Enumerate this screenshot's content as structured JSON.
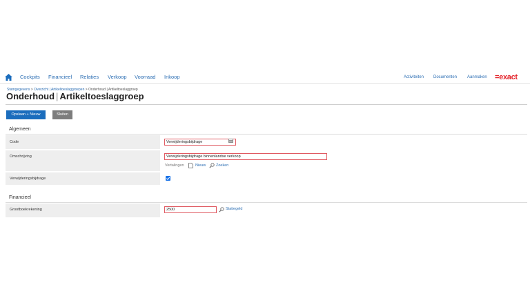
{
  "nav": {
    "items": [
      "Cockpits",
      "Financieel",
      "Relaties",
      "Verkoop",
      "Voorraad",
      "Inkoop"
    ],
    "right": [
      "Activiteiten",
      "Documenten",
      "Aanmaken"
    ],
    "logo": "=exact"
  },
  "breadcrumb": {
    "stamgegevens": "Stamgegevens",
    "sep1": " > ",
    "overzicht": "Overzicht | Artikeltoeslaggroepen",
    "sep2": " > ",
    "current": "Onderhoud | Artikeltoeslaggroep"
  },
  "title": {
    "part1": "Onderhoud",
    "sep": "|",
    "part2": "Artikeltoeslaggroep"
  },
  "buttons": {
    "save_new": "Opslaan + Nieuw",
    "close": "Sluiten"
  },
  "algemeen": {
    "title": "Algemeen",
    "code_label": "Code",
    "code_value": "Verwijderingsbijdrage",
    "omschrijving_label": "Omschrijving",
    "omschrijving_value": "Verwijderingsbijdrage binnenlandse verkoop",
    "vertalingen": "Vertalingen",
    "nieuw": "Nieuw",
    "zoeken": "Zoeken",
    "verwijdering_label": "Verwijderingsbijdrage",
    "verwijdering_checked": true
  },
  "financieel": {
    "title": "Financieel",
    "grootboek_label": "Grootboekrekening",
    "grootboek_value": "2500",
    "grootboek_link": "Statiegeld"
  },
  "colors": {
    "accent": "#1b6dbd",
    "link": "#2a6db3",
    "brand": "#e4242b",
    "invalid_border": "#e05a62"
  }
}
